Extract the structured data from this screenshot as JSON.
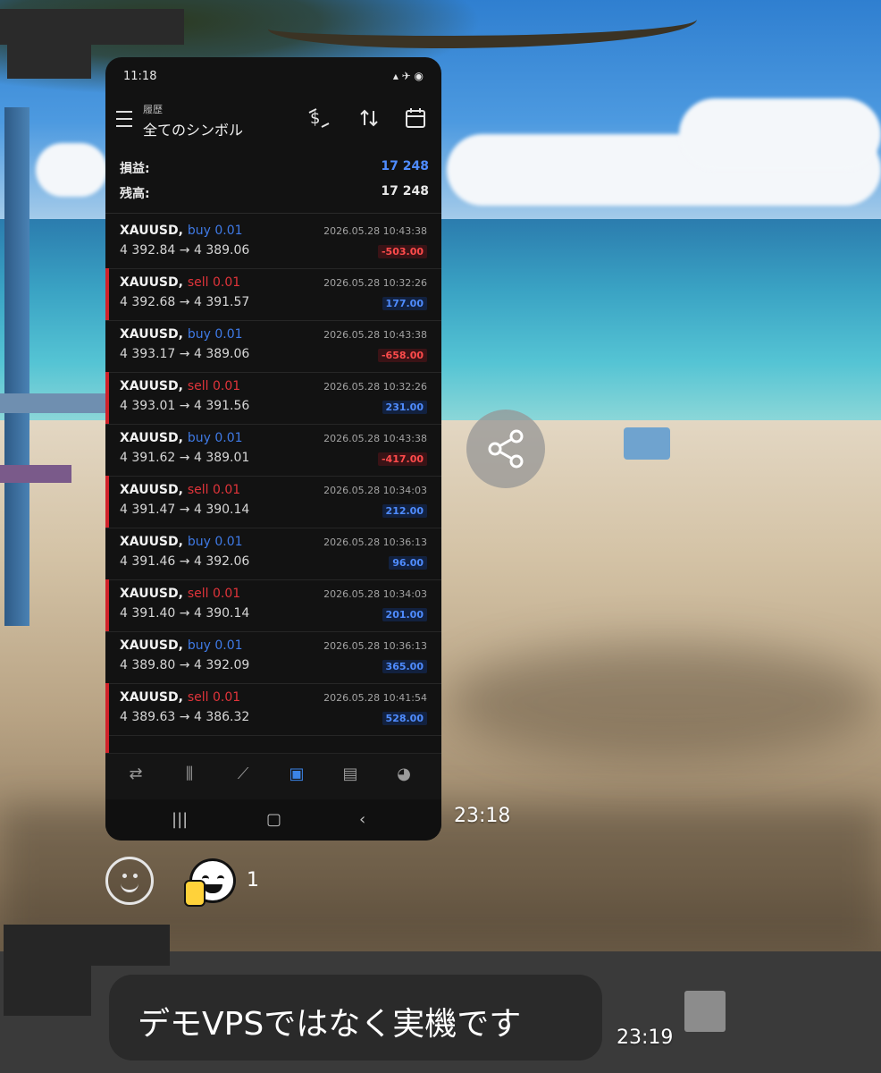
{
  "phone": {
    "status_time": "11:18",
    "status_icons": "▴ ✈ ◉",
    "header": {
      "subtitle": "履歴",
      "title": "全てのシンボル",
      "icons": [
        "currency-exchange-icon",
        "sort-icon",
        "calendar-icon"
      ]
    },
    "summary": {
      "profit_label": "損益:",
      "profit_value": "17 248",
      "balance_label": "残高:",
      "balance_value": "17 248"
    },
    "trades": [
      {
        "symbol": "XAUUSD,",
        "side": "buy 0.01",
        "type": "buy",
        "price": "4 392.84 → 4 389.06",
        "date": "2026.05.28 10:43:38",
        "pl": "-503.00",
        "pl_sign": "neg"
      },
      {
        "symbol": "XAUUSD,",
        "side": "sell 0.01",
        "type": "sell",
        "price": "4 392.68 → 4 391.57",
        "date": "2026.05.28 10:32:26",
        "pl": "177.00",
        "pl_sign": "pos"
      },
      {
        "symbol": "XAUUSD,",
        "side": "buy 0.01",
        "type": "buy",
        "price": "4 393.17 → 4 389.06",
        "date": "2026.05.28 10:43:38",
        "pl": "-658.00",
        "pl_sign": "neg"
      },
      {
        "symbol": "XAUUSD,",
        "side": "sell 0.01",
        "type": "sell",
        "price": "4 393.01 → 4 391.56",
        "date": "2026.05.28 10:32:26",
        "pl": "231.00",
        "pl_sign": "pos"
      },
      {
        "symbol": "XAUUSD,",
        "side": "buy 0.01",
        "type": "buy",
        "price": "4 391.62 → 4 389.01",
        "date": "2026.05.28 10:43:38",
        "pl": "-417.00",
        "pl_sign": "neg"
      },
      {
        "symbol": "XAUUSD,",
        "side": "sell 0.01",
        "type": "sell",
        "price": "4 391.47 → 4 390.14",
        "date": "2026.05.28 10:34:03",
        "pl": "212.00",
        "pl_sign": "pos"
      },
      {
        "symbol": "XAUUSD,",
        "side": "buy 0.01",
        "type": "buy",
        "price": "4 391.46 → 4 392.06",
        "date": "2026.05.28 10:36:13",
        "pl": "96.00",
        "pl_sign": "pos"
      },
      {
        "symbol": "XAUUSD,",
        "side": "sell 0.01",
        "type": "sell",
        "price": "4 391.40 → 4 390.14",
        "date": "2026.05.28 10:34:03",
        "pl": "201.00",
        "pl_sign": "pos"
      },
      {
        "symbol": "XAUUSD,",
        "side": "buy 0.01",
        "type": "buy",
        "price": "4 389.80 → 4 392.09",
        "date": "2026.05.28 10:36:13",
        "pl": "365.00",
        "pl_sign": "pos"
      },
      {
        "symbol": "XAUUSD,",
        "side": "sell 0.01",
        "type": "sell",
        "price": "4 389.63 → 4 386.32",
        "date": "2026.05.28 10:41:54",
        "pl": "528.00",
        "pl_sign": "pos"
      }
    ],
    "bottom_nav": [
      {
        "icon": "quotes-icon",
        "glyph": "⇄"
      },
      {
        "icon": "chart-candles-icon",
        "glyph": "⫼"
      },
      {
        "icon": "trade-icon",
        "glyph": "⟋"
      },
      {
        "icon": "history-icon",
        "glyph": "▣",
        "active": true
      },
      {
        "icon": "news-icon",
        "glyph": "▤"
      },
      {
        "icon": "chat-icon",
        "glyph": "◕"
      }
    ],
    "system_nav": [
      {
        "icon": "recent-apps-icon",
        "glyph": "|||"
      },
      {
        "icon": "home-icon",
        "glyph": "▢"
      },
      {
        "icon": "back-icon",
        "glyph": "‹"
      }
    ]
  },
  "chat": {
    "image_time": "23:18",
    "reaction_count": "1",
    "message_text": "デモVPSではなく実機です",
    "message_time": "23:19"
  },
  "colors": {
    "buy": "#3f7ae6",
    "sell": "#e0343a",
    "profit_blue": "#4f8cff",
    "loss_red": "#ff4b4b"
  }
}
